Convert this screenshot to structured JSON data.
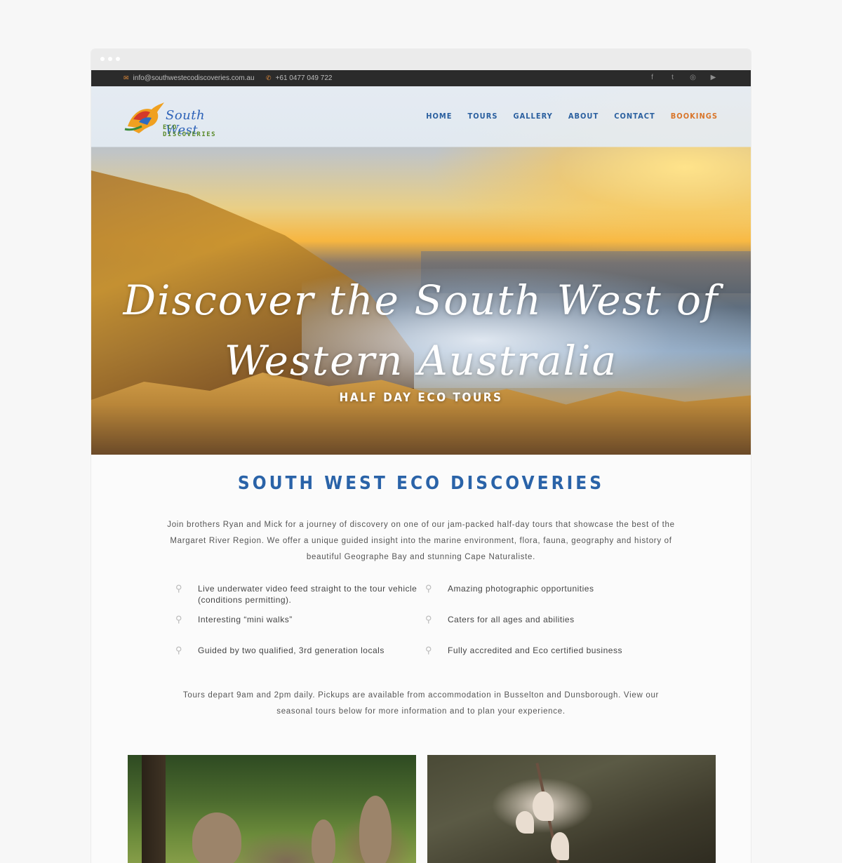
{
  "topbar": {
    "email": "info@southwestecodiscoveries.com.au",
    "phone": "+61 0477 049 722",
    "email_icon": "envelope-icon",
    "phone_icon": "phone-icon",
    "socials": [
      "facebook-icon",
      "twitter-icon",
      "instagram-icon",
      "youtube-icon"
    ]
  },
  "logo": {
    "line1": "South West",
    "line2": "ECO DISCOVERIES"
  },
  "nav": {
    "home": "HOME",
    "tours": "TOURS",
    "gallery": "GALLERY",
    "about": "ABOUT",
    "contact": "CONTACT",
    "bookings": "BOOKINGS"
  },
  "hero": {
    "title_line1": "Discover the South West of",
    "title_line2": "Western Australia",
    "subtitle": "HALF DAY ECO TOURS"
  },
  "main": {
    "heading": "SOUTH WEST ECO DISCOVERIES",
    "intro": "Join brothers Ryan and Mick for a journey of discovery on one of our jam-packed half-day tours that showcase the best of the Margaret River Region. We offer a unique guided insight into the marine environment, flora, fauna, geography and history of beautiful Geographe Bay and stunning Cape Naturaliste.",
    "features": [
      "Live underwater video feed straight to the tour vehicle (conditions permitting).",
      "Amazing photographic opportunities",
      "Interesting “mini walks”",
      "Caters for all ages and abilities",
      "Guided by two qualified, 3rd generation locals",
      "Fully accredited and Eco certified business"
    ],
    "outro": "Tours depart 9am and 2pm daily. Pickups are available from accommodation in Busselton and Dunsborough. View our seasonal tours below for more information and to plan your experience."
  },
  "colors": {
    "brand_blue": "#2a63a8",
    "accent_orange": "#d9752a",
    "topbar": "#2b2b2b"
  }
}
